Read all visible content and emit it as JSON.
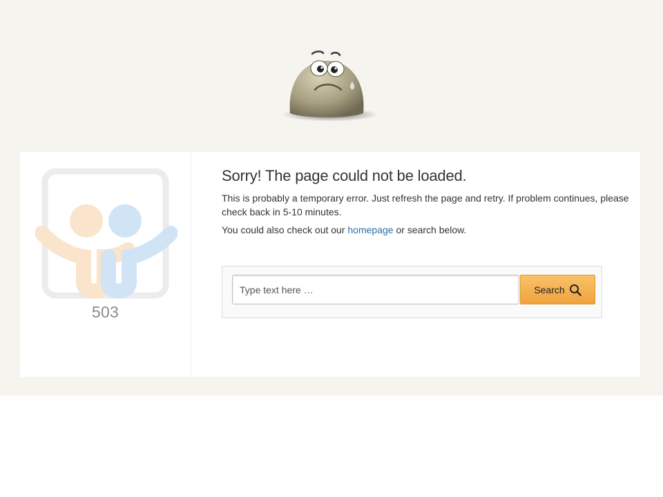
{
  "error": {
    "code": "503",
    "title": "Sorry! The page could not be loaded.",
    "description": "This is probably a temporary error. Just refresh the page and retry. If problem continues, please check back in 5-10 minutes.",
    "also_prefix": "You could also check out our ",
    "homepage_link": "homepage",
    "also_suffix": " or search below."
  },
  "search": {
    "placeholder": "Type text here …",
    "button_label": "Search",
    "button_icon": "magnifier-icon"
  },
  "colors": {
    "page_background": "#f5f4ee",
    "card_background": "#ffffff",
    "link": "#2a6fa8",
    "button_orange": "#f0a23c"
  },
  "icons": {
    "mascot": "sad-face-mascot-icon",
    "logo": "slideshare-logo-icon"
  }
}
